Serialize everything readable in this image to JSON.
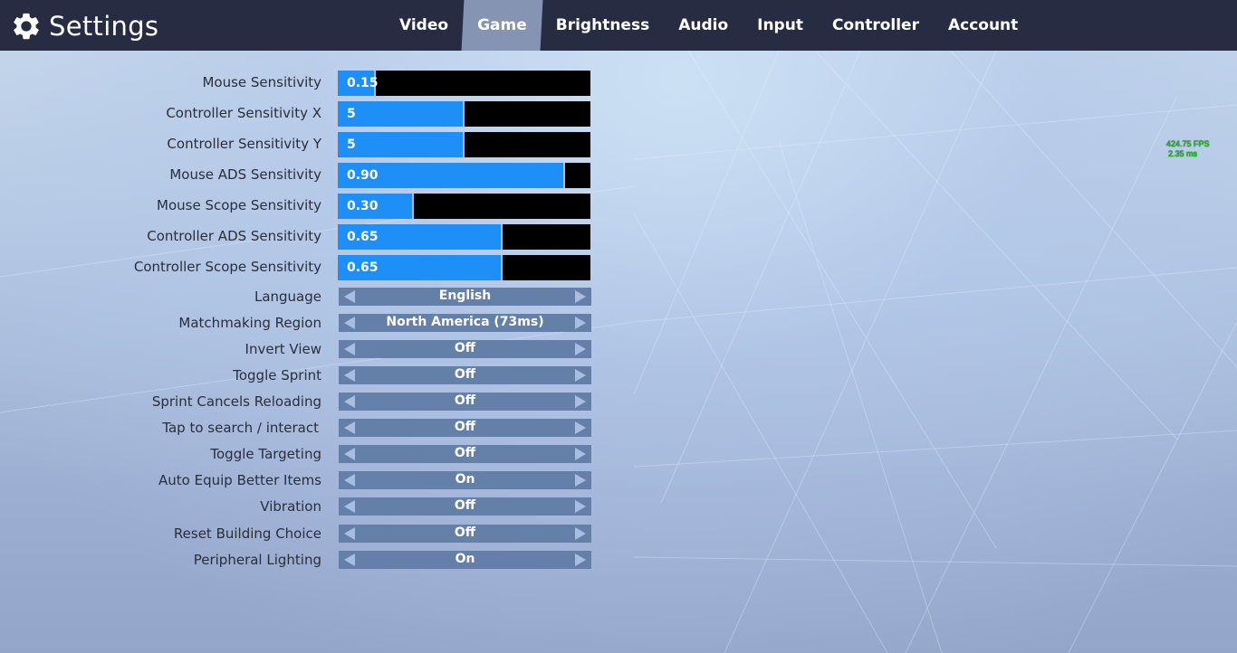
{
  "header": {
    "title": "Settings",
    "icon": "gear-icon",
    "tabs": [
      {
        "label": "Video",
        "active": false
      },
      {
        "label": "Game",
        "active": true
      },
      {
        "label": "Brightness",
        "active": false
      },
      {
        "label": "Audio",
        "active": false
      },
      {
        "label": "Input",
        "active": false
      },
      {
        "label": "Controller",
        "active": false
      },
      {
        "label": "Account",
        "active": false
      }
    ]
  },
  "colors": {
    "header_bg": "#282c42",
    "active_tab": "#8694b4",
    "slider_fill": "#1d8ff6",
    "slider_track": "#000000",
    "selector_bg": "#6580a8",
    "fps_text": "#1fd11f"
  },
  "sliders": [
    {
      "label": "Mouse Sensitivity",
      "value": "0.15",
      "fill_fraction": 0.145
    },
    {
      "label": "Controller Sensitivity X",
      "value": "5",
      "fill_fraction": 0.495
    },
    {
      "label": "Controller Sensitivity Y",
      "value": "5",
      "fill_fraction": 0.495
    },
    {
      "label": "Mouse ADS Sensitivity",
      "value": "0.90",
      "fill_fraction": 0.892
    },
    {
      "label": "Mouse Scope Sensitivity",
      "value": "0.30",
      "fill_fraction": 0.294
    },
    {
      "label": "Controller ADS Sensitivity",
      "value": "0.65",
      "fill_fraction": 0.645
    },
    {
      "label": "Controller Scope Sensitivity",
      "value": "0.65",
      "fill_fraction": 0.645
    }
  ],
  "selectors": [
    {
      "label": "Language",
      "value": "English"
    },
    {
      "label": "Matchmaking Region",
      "value": "North America (73ms)"
    },
    {
      "label": "Invert View",
      "value": "Off"
    },
    {
      "label": "Toggle Sprint",
      "value": "Off"
    },
    {
      "label": "Sprint Cancels Reloading",
      "value": "Off"
    },
    {
      "label": "Tap to search / interact",
      "value": "Off"
    },
    {
      "label": "Toggle Targeting",
      "value": "Off"
    },
    {
      "label": "Auto Equip Better Items",
      "value": "On"
    },
    {
      "label": "Vibration",
      "value": "Off"
    },
    {
      "label": "Reset Building Choice",
      "value": "Off"
    },
    {
      "label": "Peripheral Lighting",
      "value": "On"
    }
  ],
  "perf": {
    "fps": "424.75 FPS",
    "frame_time": "2.35 ms"
  }
}
